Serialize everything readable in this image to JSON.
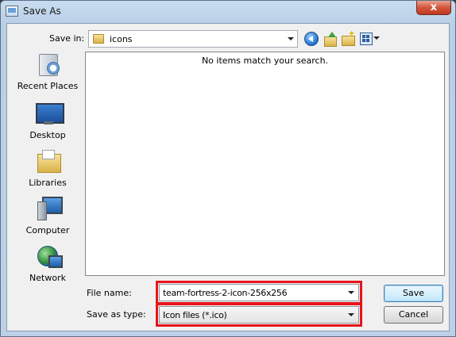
{
  "window": {
    "title": "Save As",
    "close_label": "x"
  },
  "toolbar": {
    "save_in_label": "Save in:",
    "location": "icons"
  },
  "places": [
    {
      "label": "Recent Places",
      "icon": "recent-places-icon"
    },
    {
      "label": "Desktop",
      "icon": "desktop-icon"
    },
    {
      "label": "Libraries",
      "icon": "libraries-icon"
    },
    {
      "label": "Computer",
      "icon": "computer-icon"
    },
    {
      "label": "Network",
      "icon": "network-icon"
    }
  ],
  "file_list": {
    "empty_message": "No items match your search."
  },
  "form": {
    "file_name_label": "File name:",
    "file_name_value": "team-fortress-2-icon-256x256",
    "save_type_label": "Save as type:",
    "save_type_value": "Icon files (*.ico)"
  },
  "buttons": {
    "save": "Save",
    "cancel": "Cancel"
  },
  "colors": {
    "highlight": "#e8141b",
    "title_bg": "#c9dcef"
  }
}
